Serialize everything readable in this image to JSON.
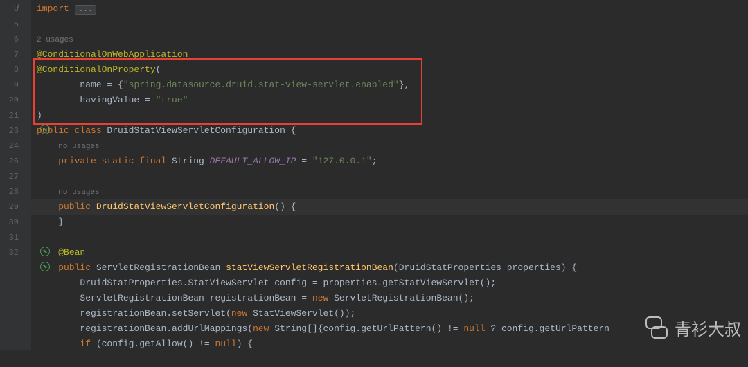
{
  "gutter": {
    "start": 8,
    "lineNumbers": [
      "8",
      "",
      "",
      "5",
      "6",
      "7",
      "8",
      "9",
      "20",
      "",
      "21",
      "",
      "",
      "23",
      "24",
      "",
      "26",
      "27",
      "28",
      "29",
      "30",
      "31",
      "32",
      ""
    ]
  },
  "code": {
    "l8_import": "import",
    "l8_badge": "...",
    "usages2": "2 usages",
    "ann_cowa": "@ConditionalOnWebApplication",
    "ann_cop": "@ConditionalOnProperty",
    "paren_open": "(",
    "name_label": "name = {",
    "name_value": "\"spring.datasource.druid.stat-view-servlet.enabled\"",
    "name_close": "},",
    "having_label": "havingValue = ",
    "having_value": "\"true\"",
    "paren_close": ")",
    "class_mods": "public class ",
    "class_name": "DruidStatViewServletConfiguration",
    "brace_open": " {",
    "no_usages": "no usages",
    "field_mods": "private static final ",
    "field_type": "String ",
    "field_name": "DEFAULT_ALLOW_IP",
    "field_eq": " = ",
    "field_val": "\"127.0.0.1\"",
    "semicolon": ";",
    "ctor_mods": "public ",
    "ctor_name": "DruidStatViewServletConfiguration",
    "ctor_sig": "() {",
    "brace_close": "}",
    "ann_bean": "@Bean",
    "m_mods": "public ",
    "m_ret": "ServletRegistrationBean ",
    "m_name": "statViewServletRegistrationBean",
    "m_sig_open": "(",
    "m_ptype": "DruidStatProperties ",
    "m_pname": "properties",
    "m_sig_close": ") {",
    "m_l1": "DruidStatProperties.StatViewServlet config = properties.getStatViewServlet();",
    "m_l2_a": "ServletRegistrationBean registrationBean = ",
    "m_l2_new": "new ",
    "m_l2_b": "ServletRegistrationBean();",
    "m_l3_a": "registrationBean.setServlet(",
    "m_l3_new": "new ",
    "m_l3_b": "StatViewServlet());",
    "m_l4_a": "registrationBean.addUrlMappings(",
    "m_l4_new": "new ",
    "m_l4_b": "String[]{config.getUrlPattern() != ",
    "m_l4_null": "null",
    "m_l4_c": " ? config.getUrlPattern",
    "m_l5_a": "if ",
    "m_l5_b": "(config.getAllow() != ",
    "m_l5_null": "null",
    "m_l5_c": ") {"
  },
  "watermark": "青衫大叔"
}
